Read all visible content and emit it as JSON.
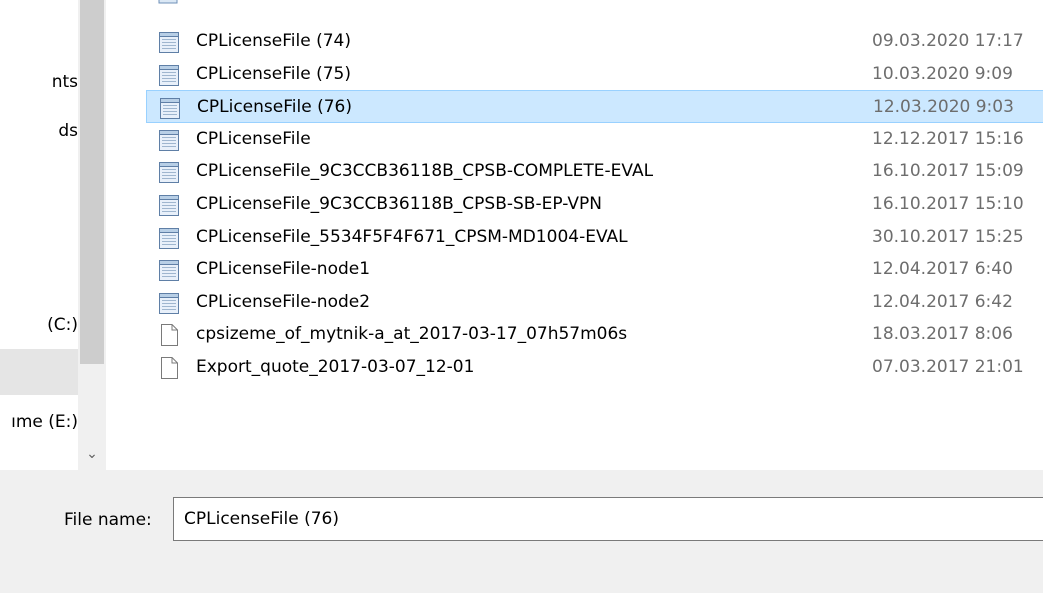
{
  "nav": {
    "items": [
      {
        "label": "nts"
      },
      {
        "label": "ds"
      },
      {
        "label": "(C:)"
      },
      {
        "label": "ıme (E:)"
      }
    ]
  },
  "files": [
    {
      "name": "CPLicenseFile (74)",
      "date": "09.03.2020 17:17",
      "icon": "text-document-icon",
      "selected": false
    },
    {
      "name": "CPLicenseFile (75)",
      "date": "10.03.2020 9:09",
      "icon": "text-document-icon",
      "selected": false
    },
    {
      "name": "CPLicenseFile (76)",
      "date": "12.03.2020 9:03",
      "icon": "text-document-icon",
      "selected": true
    },
    {
      "name": "CPLicenseFile",
      "date": "12.12.2017 15:16",
      "icon": "text-document-icon",
      "selected": false
    },
    {
      "name": "CPLicenseFile_9C3CCB36118B_CPSB-COMPLETE-EVAL",
      "date": "16.10.2017 15:09",
      "icon": "text-document-icon",
      "selected": false
    },
    {
      "name": "CPLicenseFile_9C3CCB36118B_CPSB-SB-EP-VPN",
      "date": "16.10.2017 15:10",
      "icon": "text-document-icon",
      "selected": false
    },
    {
      "name": "CPLicenseFile_5534F5F4F671_CPSM-MD1004-EVAL",
      "date": "30.10.2017 15:25",
      "icon": "text-document-icon",
      "selected": false
    },
    {
      "name": "CPLicenseFile-node1",
      "date": "12.04.2017 6:40",
      "icon": "text-document-icon",
      "selected": false
    },
    {
      "name": "CPLicenseFile-node2",
      "date": "12.04.2017 6:42",
      "icon": "text-document-icon",
      "selected": false
    },
    {
      "name": "cpsizeme_of_mytnik-a_at_2017-03-17_07h57m06s",
      "date": "18.03.2017 8:06",
      "icon": "blank-file-icon",
      "selected": false
    },
    {
      "name": "Export_quote_2017-03-07_12-01",
      "date": "07.03.2017 21:01",
      "icon": "blank-file-icon",
      "selected": false
    }
  ],
  "bottom": {
    "filename_label": "File name:",
    "filename_value": "CPLicenseFile (76)"
  }
}
